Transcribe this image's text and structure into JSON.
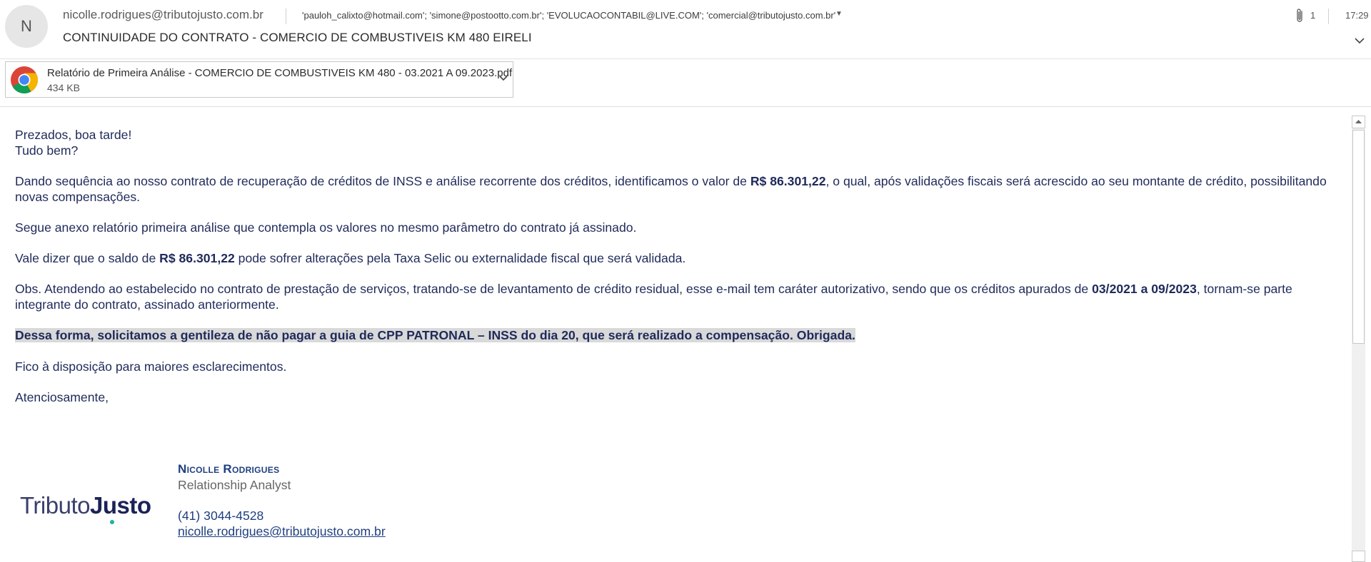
{
  "header": {
    "avatar_letter": "N",
    "sender": "nicolle.rodrigues@tributojusto.com.br",
    "recipients": "'pauloh_calixto@hotmail.com'; 'simone@postootto.com.br'; 'EVOLUCAOCONTABIL@LIVE.COM'; 'comercial@tributojusto.com.br'",
    "attachment_count": "1",
    "time": "17:29",
    "subject": "CONTINUIDADE DO CONTRATO - COMERCIO DE COMBUSTIVEIS KM 480 EIRELI"
  },
  "attachment": {
    "name": "Relatório de Primeira Análise - COMERCIO DE COMBUSTIVEIS KM 480 - 03.2021 A 09.2023.pdf",
    "size": "434 KB"
  },
  "body": {
    "greeting": "Prezados, boa tarde!",
    "greeting2": "Tudo bem?",
    "p1_a": "Dando sequência ao nosso contrato de recuperação de créditos de INSS e análise recorrente dos créditos, identificamos o valor de ",
    "p1_amount": "R$ 86.301,22",
    "p1_b": ", o qual, após validações fiscais será acrescido ao seu montante de crédito, possibilitando novas compensações.",
    "p2": "Segue anexo relatório primeira análise que contempla os valores no mesmo parâmetro do contrato já assinado.",
    "p3_a": "Vale dizer que o saldo de ",
    "p3_amount": "R$ 86.301,22",
    "p3_b": " pode sofrer alterações pela Taxa Selic ou externalidade fiscal que será validada.",
    "p4_a": "Obs. Atendendo ao estabelecido no contrato de prestação de serviços, tratando-se de levantamento de crédito residual, esse e-mail tem caráter autorizativo, sendo que os créditos apurados de ",
    "p4_period": "03/2021 a 09/2023",
    "p4_b": ", tornam-se parte integrante do contrato, assinado anteriormente.",
    "p5": "Dessa forma, solicitamos a gentileza de não pagar a guia de CPP PATRONAL – INSS do dia 20, que será realizado a compensação. Obrigada.",
    "p6": "Fico à disposição para maiores esclarecimentos.",
    "closing": "Atenciosamente,"
  },
  "signature": {
    "logo_part1": "Tributo",
    "logo_part2": "Justo",
    "name": "Nicolle Rodrigues",
    "role": "Relationship Analyst",
    "phone": "(41) 3044-4528",
    "email": "nicolle.rodrigues@tributojusto.com.br"
  },
  "icons": {
    "attach": "paperclip-icon",
    "expand": "chevron-down-icon",
    "attachment_file": "chrome-icon",
    "attachment_menu": "chevron-down-icon"
  },
  "colors": {
    "body_text": "#1f2a5a",
    "highlight": "#d9d9d9",
    "logo_dark": "#1b2257",
    "logo_accent": "#1fb39a"
  }
}
